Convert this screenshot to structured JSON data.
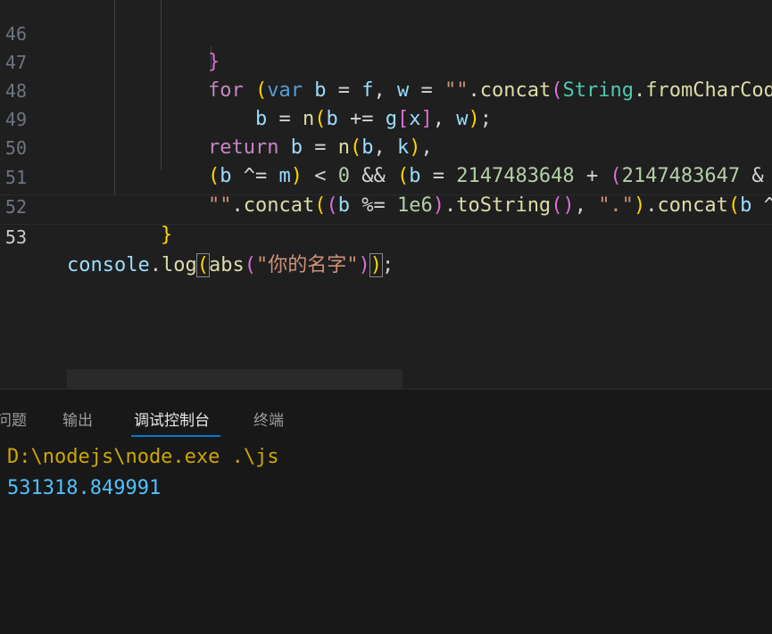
{
  "editor": {
    "lines": [
      {
        "num": "46",
        "text": "}"
      },
      {
        "num": "47",
        "text": "for (var b = f, w = \"\".concat(String.fromCharCod"
      },
      {
        "num": "48",
        "text": "b = n(b += g[x], w);"
      },
      {
        "num": "49",
        "text": "return b = n(b, k),"
      },
      {
        "num": "50",
        "text": "(b ^= m) < 0 && (b = 2147483648 + (2147483647 &"
      },
      {
        "num": "51",
        "text": "\"\".concat((b %= 1e6).toString(), \".\").concat(b ^"
      },
      {
        "num": "52",
        "text": "}"
      },
      {
        "num": "53",
        "text": "console.log(abs(\"你的名字\"));"
      }
    ],
    "active_line": "53"
  },
  "panel": {
    "tabs": [
      {
        "label": "问题",
        "active": false
      },
      {
        "label": "输出",
        "active": false
      },
      {
        "label": "调试控制台",
        "active": true
      },
      {
        "label": "终端",
        "active": false
      }
    ],
    "output": {
      "command": "D:\\nodejs\\node.exe .\\js",
      "result": "531318.849991"
    }
  },
  "colors": {
    "keyword": "#c586c0",
    "string": "#ce9178",
    "number": "#b5cea8",
    "function": "#dcdcaa",
    "variable": "#9cdcfe",
    "class": "#4ec9b0",
    "command_output": "#cca700",
    "result_output": "#4fc1ff",
    "tab_active_underline": "#0078d4"
  }
}
